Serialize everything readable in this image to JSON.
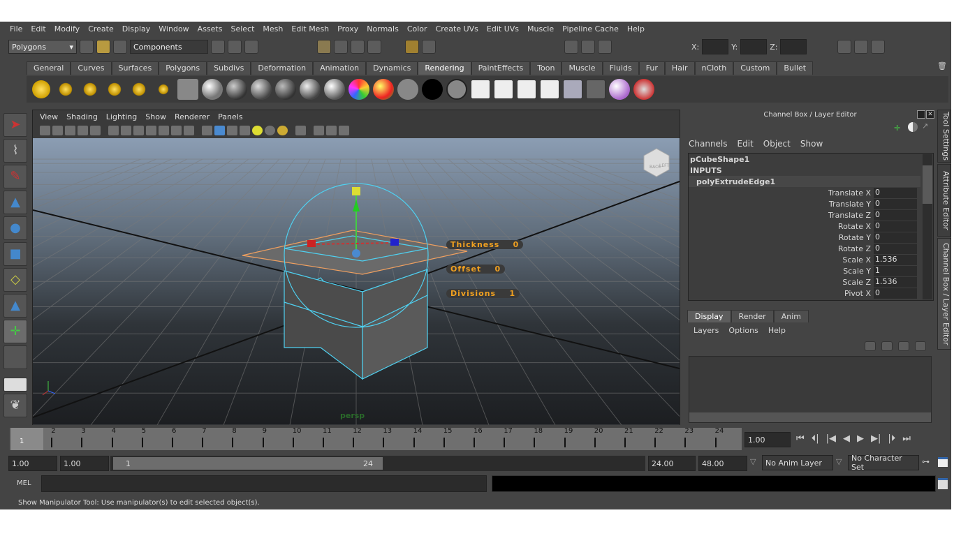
{
  "menu": [
    "File",
    "Edit",
    "Modify",
    "Create",
    "Display",
    "Window",
    "Assets",
    "Select",
    "Mesh",
    "Edit Mesh",
    "Proxy",
    "Normals",
    "Color",
    "Create UVs",
    "Edit UVs",
    "Muscle",
    "Pipeline Cache",
    "Help"
  ],
  "status": {
    "mode": "Polygons",
    "components": "Components",
    "x_label": "X:",
    "y_label": "Y:",
    "z_label": "Z:",
    "x_value": "",
    "y_value": "",
    "z_value": ""
  },
  "shelf_tabs": [
    "General",
    "Curves",
    "Surfaces",
    "Polygons",
    "Subdivs",
    "Deformation",
    "Animation",
    "Dynamics",
    "Rendering",
    "PaintEffects",
    "Toon",
    "Muscle",
    "Fluids",
    "Fur",
    "Hair",
    "nCloth",
    "Custom",
    "Bullet"
  ],
  "active_shelf_tab": "Rendering",
  "viewport": {
    "menu": [
      "View",
      "Shading",
      "Lighting",
      "Show",
      "Renderer",
      "Panels"
    ],
    "camera": "persp",
    "hud": [
      {
        "label": "Thickness",
        "value": "0"
      },
      {
        "label": "Offset",
        "value": "0"
      },
      {
        "label": "Divisions",
        "value": "1"
      }
    ],
    "viewcube_labels": [
      "BACK",
      "LEFT"
    ]
  },
  "channel_box": {
    "title": "Channel Box / Layer Editor",
    "menu": [
      "Channels",
      "Edit",
      "Object",
      "Show"
    ],
    "shape": "pCubeShape1",
    "inputs": "INPUTS",
    "node": "polyExtrudeEdge1",
    "channels": [
      {
        "name": "Translate X",
        "value": "0"
      },
      {
        "name": "Translate Y",
        "value": "0"
      },
      {
        "name": "Translate Z",
        "value": "0"
      },
      {
        "name": "Rotate X",
        "value": "0"
      },
      {
        "name": "Rotate Y",
        "value": "0"
      },
      {
        "name": "Rotate Z",
        "value": "0"
      },
      {
        "name": "Scale X",
        "value": "1.536"
      },
      {
        "name": "Scale Y",
        "value": "1"
      },
      {
        "name": "Scale Z",
        "value": "1.536"
      },
      {
        "name": "Pivot X",
        "value": "0"
      }
    ]
  },
  "side_tabs": [
    "Tool Settings",
    "Attribute Editor",
    "Channel Box / Layer Editor"
  ],
  "layer_editor": {
    "tabs": [
      "Display",
      "Render",
      "Anim"
    ],
    "active_tab": "Display",
    "menu": [
      "Layers",
      "Options",
      "Help"
    ]
  },
  "timeline": {
    "ticks": [
      "1",
      "2",
      "3",
      "4",
      "5",
      "6",
      "7",
      "8",
      "9",
      "10",
      "11",
      "12",
      "13",
      "14",
      "15",
      "16",
      "17",
      "18",
      "19",
      "20",
      "21",
      "22",
      "23",
      "24"
    ],
    "current_frame_marker": "1",
    "current_time": "1.00"
  },
  "range": {
    "start": "1.00",
    "playback_start": "1.00",
    "slider_start": "1",
    "slider_end": "24",
    "playback_end": "24.00",
    "end": "48.00",
    "anim_layer": "No Anim Layer",
    "character_set": "No Character Set"
  },
  "command_line": {
    "label": "MEL",
    "value": "",
    "result": ""
  },
  "help_line": "Show Manipulator Tool: Use manipulator(s) to edit selected object(s).",
  "colors": {
    "accent_hud": "#f0a020",
    "selection": "#4fd0f0",
    "background": "#444444"
  }
}
